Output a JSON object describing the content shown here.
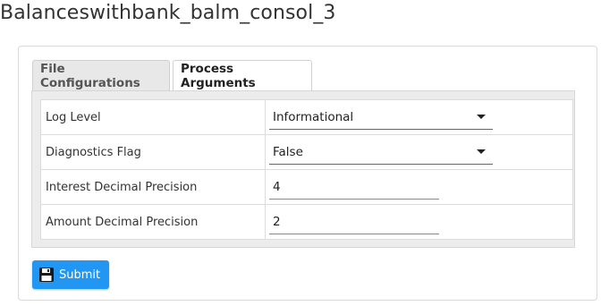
{
  "page": {
    "title": "Balanceswithbank_balm_consol_3"
  },
  "tabs": [
    {
      "label": "File Configurations",
      "active": false
    },
    {
      "label": "Process Arguments",
      "active": true
    }
  ],
  "arguments": [
    {
      "label": "Log Level",
      "type": "select",
      "value": "Informational"
    },
    {
      "label": "Diagnostics Flag",
      "type": "select",
      "value": "False"
    },
    {
      "label": "Interest Decimal Precision",
      "type": "text",
      "value": "4"
    },
    {
      "label": "Amount Decimal Precision",
      "type": "text",
      "value": "2"
    }
  ],
  "actions": {
    "submit_label": "Submit",
    "submit_icon": "floppy-disk-icon"
  },
  "colors": {
    "accent": "#2196f3"
  }
}
